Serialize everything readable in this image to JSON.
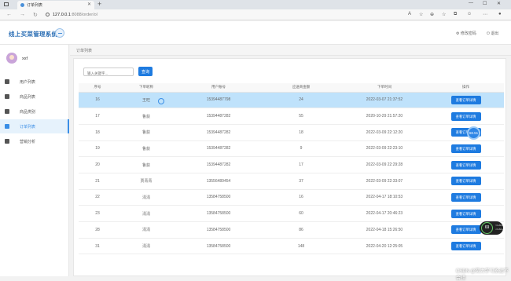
{
  "browser": {
    "tab_title": "订单列表",
    "url_host": "127.0.0.1",
    "url_path": ":8088/order/ol"
  },
  "header": {
    "app_title": "线上买菜管理系统",
    "change_password": "修改密码",
    "logout": "退出"
  },
  "user": {
    "name": "xxf"
  },
  "sidebar": {
    "items": [
      {
        "label": "用户列表",
        "icon": "users-icon"
      },
      {
        "label": "商品列表",
        "icon": "utensils-icon"
      },
      {
        "label": "商品类别",
        "icon": "tag-icon"
      },
      {
        "label": "订单列表",
        "icon": "file-icon",
        "active": true
      },
      {
        "label": "营销分析",
        "icon": "chart-icon"
      }
    ]
  },
  "breadcrumb": "订单列表",
  "search": {
    "placeholder": "输入关键字...",
    "button": "查询"
  },
  "table": {
    "headers": [
      "序号",
      "下单昵称",
      "用户账号",
      "应送商金额",
      "下单时间",
      "操作"
    ],
    "rows": [
      [
        "16",
        "王旺",
        "15394487798",
        "24",
        "2022-03-07 21:37:52",
        "查看订单详情"
      ],
      [
        "17",
        "鲁荻",
        "15394487282",
        "55",
        "2020-10-29 21:57:20",
        "查看订单详情"
      ],
      [
        "18",
        "鲁荻",
        "15394487282",
        "18",
        "2022-03-09 22:12:20",
        "查看订单详情"
      ],
      [
        "19",
        "鲁荻",
        "15394487282",
        "9",
        "2022-03-09 22:23:10",
        "查看订单详情"
      ],
      [
        "20",
        "鲁荻",
        "15394487282",
        "17",
        "2022-03-09 22:29:28",
        "查看订单详情"
      ],
      [
        "21",
        "贾青青",
        "13556489454",
        "37",
        "2022-03-09 22:33:07",
        "查看订单详情"
      ],
      [
        "22",
        "涓涓",
        "13584758500",
        "16",
        "2022-04-17 18:10:53",
        "查看订单详情"
      ],
      [
        "23",
        "涓涓",
        "13584758500",
        "60",
        "2022-04-17 20:46:23",
        "查看订单详情"
      ],
      [
        "28",
        "涓涓",
        "13584758500",
        "86",
        "2022-04-18 15:26:50",
        "查看订单详情"
      ],
      [
        "31",
        "涓涓",
        "13584758500",
        "148",
        "2022-04-20 12:25:05",
        "查看订单详情"
      ]
    ]
  },
  "overlays": {
    "badge": "68.51",
    "net_pct": "69",
    "net_up": "↑0.2k/s",
    "net_down": "↓0.2k/s",
    "watermark": "CSDN @努力学习永远不会错"
  }
}
